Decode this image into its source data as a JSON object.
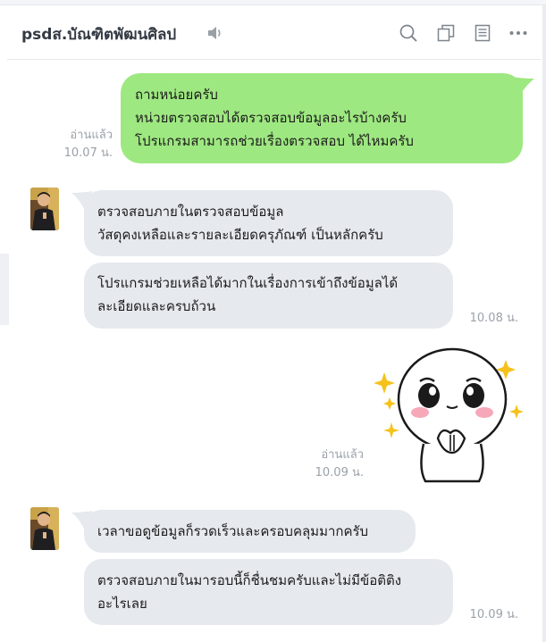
{
  "header": {
    "title": "psdส.บัณฑิตพัฒนศิลป",
    "icons": [
      "speaker-icon",
      "search-icon",
      "copy-icon",
      "notes-icon",
      "more-icon"
    ]
  },
  "messages": {
    "m1": {
      "text": "ถามหน่อยครับ\nหน่วยตรวจสอบได้ตรวจสอบข้อมูลอะไรบ้างครับ\nโปรแกรมสามารถช่วยเรื่องตรวจสอบ ได้ไหมครับ",
      "read": "อ่านแล้ว",
      "time": "10.07 น."
    },
    "m2": {
      "text": "ตรวจสอบภายในตรวจสอบข้อมูล\nวัสดุคงเหลือและรายละเอียดครุภัณฑ์ เป็นหลักครับ"
    },
    "m3": {
      "text": "โปรแกรมช่วยเหลือได้มากในเรื่องการเข้าถึงข้อมูลได้\nละเอียดและครบถ้วน",
      "time": "10.08 น."
    },
    "m4": {
      "read": "อ่านแล้ว",
      "time": "10.09 น."
    },
    "m5": {
      "text": "เวลาขอดูข้อมูลก็รวดเร็วและครอบคลุมมากครับ"
    },
    "m6": {
      "text": "ตรวจสอบภายในมารอบนี้ก็ชื่นชมครับและไม่มีข้อติติง\nอะไรเลย",
      "time": "10.09 น."
    }
  },
  "colors": {
    "sent_bubble": "#9ee881",
    "received_bubble": "#e6e9ee",
    "meta_text": "#9aa1a9"
  }
}
